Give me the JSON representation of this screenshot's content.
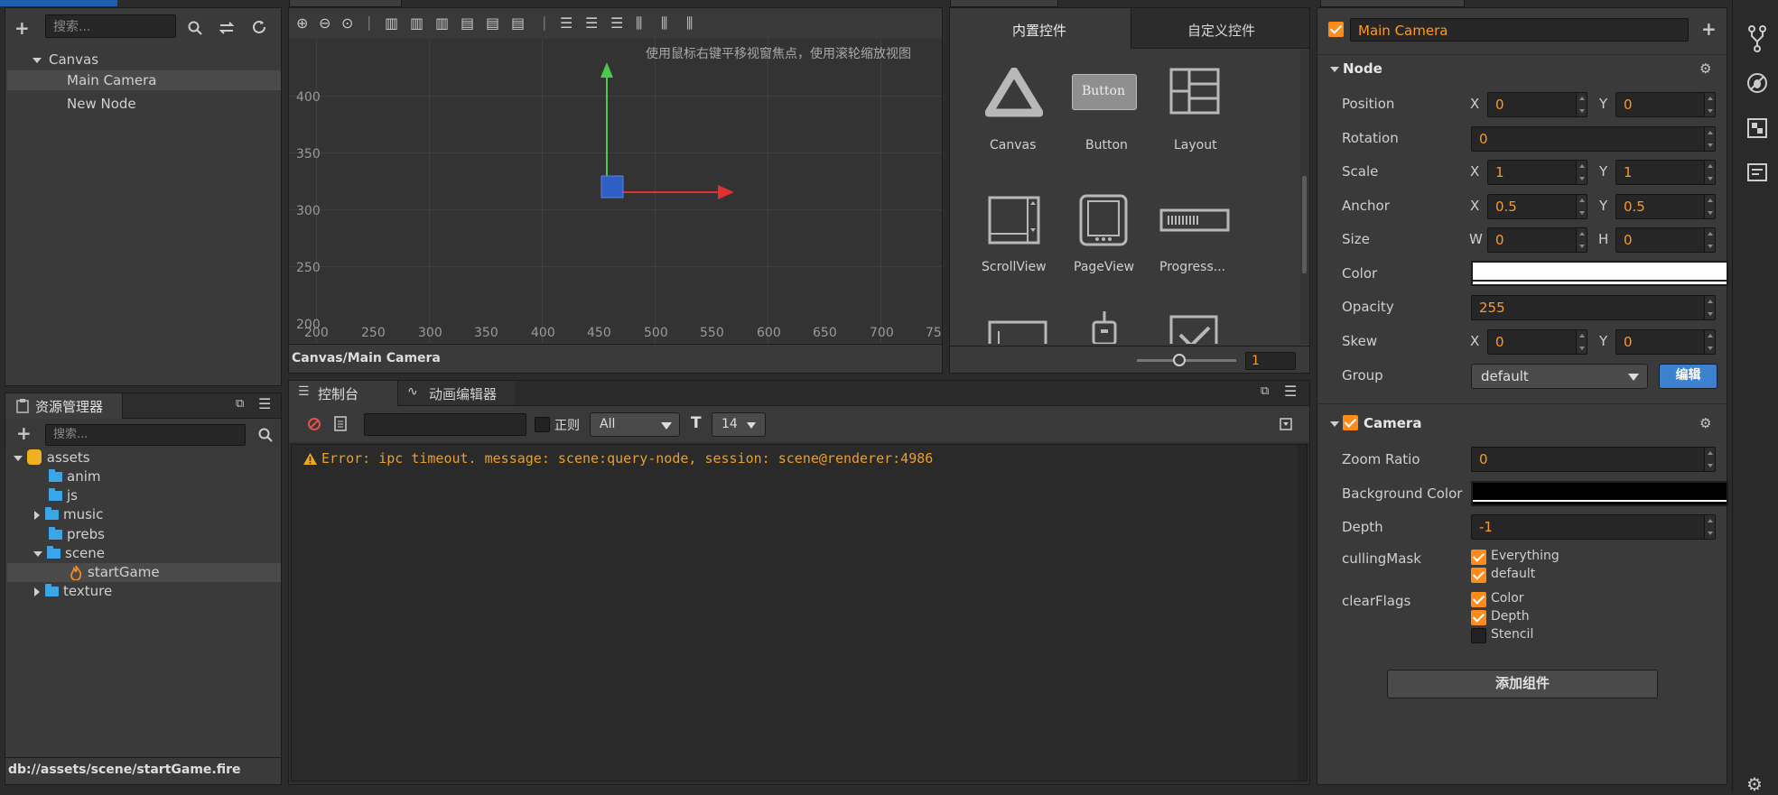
{
  "hierarchy": {
    "search_placeholder": "搜索...",
    "items": [
      "Canvas",
      "Main Camera",
      "New Node"
    ]
  },
  "scene_view": {
    "hint": "使用鼠标右键平移视窗焦点，使用滚轮缩放视图",
    "y_ticks": [
      "400",
      "350",
      "300",
      "250",
      "200"
    ],
    "x_ticks": [
      "200",
      "250",
      "300",
      "350",
      "400",
      "450",
      "500",
      "550",
      "600",
      "650",
      "700",
      "75"
    ],
    "path": "Canvas/Main Camera"
  },
  "widget_library": {
    "tab_builtin": "内置控件",
    "tab_custom": "自定义控件",
    "widgets": [
      "Canvas",
      "Button",
      "Layout",
      "ScrollView",
      "PageView",
      "Progress..."
    ],
    "button_preview": "Button",
    "zoom_value": "1"
  },
  "assets": {
    "title": "资源管理器",
    "search_placeholder": "搜索...",
    "root": "assets",
    "folders": [
      "anim",
      "js",
      "music",
      "prebs",
      "scene",
      "startGame",
      "texture"
    ],
    "path": "db://assets/scene/startGame.fire"
  },
  "console": {
    "tab_console": "控制台",
    "tab_anim": "动画编辑器",
    "regex_label": "正则",
    "filter": "All",
    "font_size": "14",
    "error": "Error: ipc timeout. message: scene:query-node, session: scene@renderer:4986"
  },
  "inspector": {
    "node_name": "Main Camera",
    "node_section": "Node",
    "labels": {
      "position": "Position",
      "rotation": "Rotation",
      "scale": "Scale",
      "anchor": "Anchor",
      "size": "Size",
      "color": "Color",
      "opacity": "Opacity",
      "skew": "Skew",
      "group": "Group"
    },
    "axis": {
      "x": "X",
      "y": "Y",
      "w": "W",
      "h": "H"
    },
    "values": {
      "pos_x": "0",
      "pos_y": "0",
      "rotation": "0",
      "scale_x": "1",
      "scale_y": "1",
      "anchor_x": "0.5",
      "anchor_y": "0.5",
      "size_w": "0",
      "size_h": "0",
      "opacity": "255",
      "skew_x": "0",
      "skew_y": "0",
      "group": "default"
    },
    "edit_button": "编辑",
    "camera_section": "Camera",
    "camera_labels": {
      "zoom": "Zoom Ratio",
      "bg": "Background Color",
      "depth": "Depth",
      "culling": "cullingMask",
      "clear": "clearFlags"
    },
    "camera_values": {
      "zoom": "0",
      "depth": "-1"
    },
    "culling_options": [
      "Everything",
      "default"
    ],
    "clear_options": [
      "Color",
      "Depth",
      "Stencil"
    ],
    "add_component": "添加组件"
  }
}
